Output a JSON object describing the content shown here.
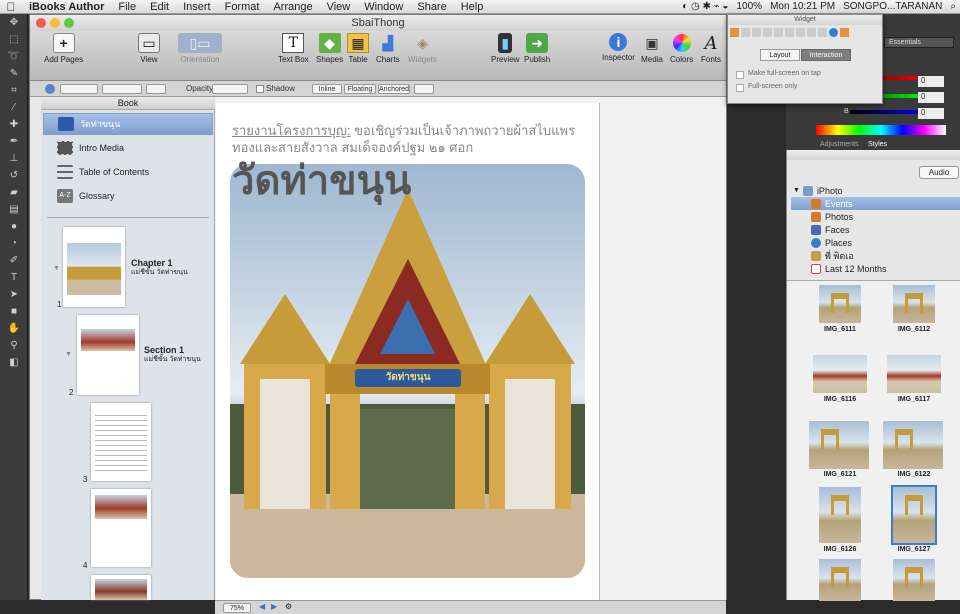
{
  "menubar": {
    "apple": "",
    "app": "iBooks Author",
    "items": [
      "File",
      "Edit",
      "Insert",
      "Format",
      "Arrange",
      "View",
      "Window",
      "Share",
      "Help"
    ],
    "battery": "100%",
    "clock": "Mon 10:21 PM",
    "user": "SONGPO...TARANAN"
  },
  "window": {
    "title": "SbaiThong",
    "toolbar": {
      "add_pages": "Add Pages",
      "view": "View",
      "orientation": "Orientation",
      "text_box": "Text Box",
      "shapes": "Shapes",
      "table": "Table",
      "charts": "Charts",
      "widgets": "Widgets",
      "preview": "Preview",
      "publish": "Publish",
      "inspector": "Inspector",
      "media": "Media",
      "colors": "Colors",
      "fonts": "Fonts"
    },
    "formatbar": {
      "opacity": "Opacity:",
      "shadow": "Shadow",
      "inline": "Inline",
      "floating": "Floating",
      "anchored": "Anchored"
    }
  },
  "sidebar": {
    "header": "Book",
    "items": [
      {
        "label": "วัดท่าขนุน",
        "selected": true
      },
      {
        "label": "Intro Media"
      },
      {
        "label": "Table of Contents"
      },
      {
        "label": "Glossary"
      }
    ],
    "chapter_title": "Chapter 1",
    "chapter_sub": "แม่ชีขั้น วัดท่าขนุน",
    "section_title": "Section 1",
    "section_sub": "แม่ชีขั้น วัดท่าขนุน",
    "page_numbers": [
      "1",
      "2",
      "3",
      "4"
    ]
  },
  "page": {
    "subtitle_underlined": "รายงานโครงการบุญ:",
    "subtitle_rest": " ขอเชิญร่วมเป็นเจ้าภาพถวายผ้าสไบแพรทองและสายสังวาล สมเด็จองค์ปฐม ๒๑ ศอก",
    "heading": "วัดท่าขนุน",
    "sign": "วัดท่าขนุน"
  },
  "zoom": "75%",
  "inspector": {
    "title": "Widget",
    "tab_layout": "Layout",
    "tab_interaction": "Interaction",
    "opt1": "Make full-screen on tap",
    "opt2": "Full-screen only"
  },
  "photoshop": {
    "essentials": "Essentials",
    "tab_adjustments": "Adjustments",
    "tab_styles": "Styles",
    "vals": [
      "0",
      "0",
      "0"
    ],
    "b_label": "B"
  },
  "media_browser": {
    "tab_audio": "Audio",
    "root": "iPhoto",
    "items": [
      "Events",
      "Photos",
      "Faces",
      "Places",
      "พี่ พิตเอ",
      "Last 12 Months"
    ],
    "photos": [
      "IMG_6111",
      "IMG_6112",
      "IMG_6116",
      "IMG_6117",
      "IMG_6121",
      "IMG_6122",
      "IMG_6126",
      "IMG_6127"
    ]
  },
  "colors": {
    "selection": "#7f9fd0",
    "menu_bg": "#e6e6e6",
    "gold": "#c69b3a"
  }
}
